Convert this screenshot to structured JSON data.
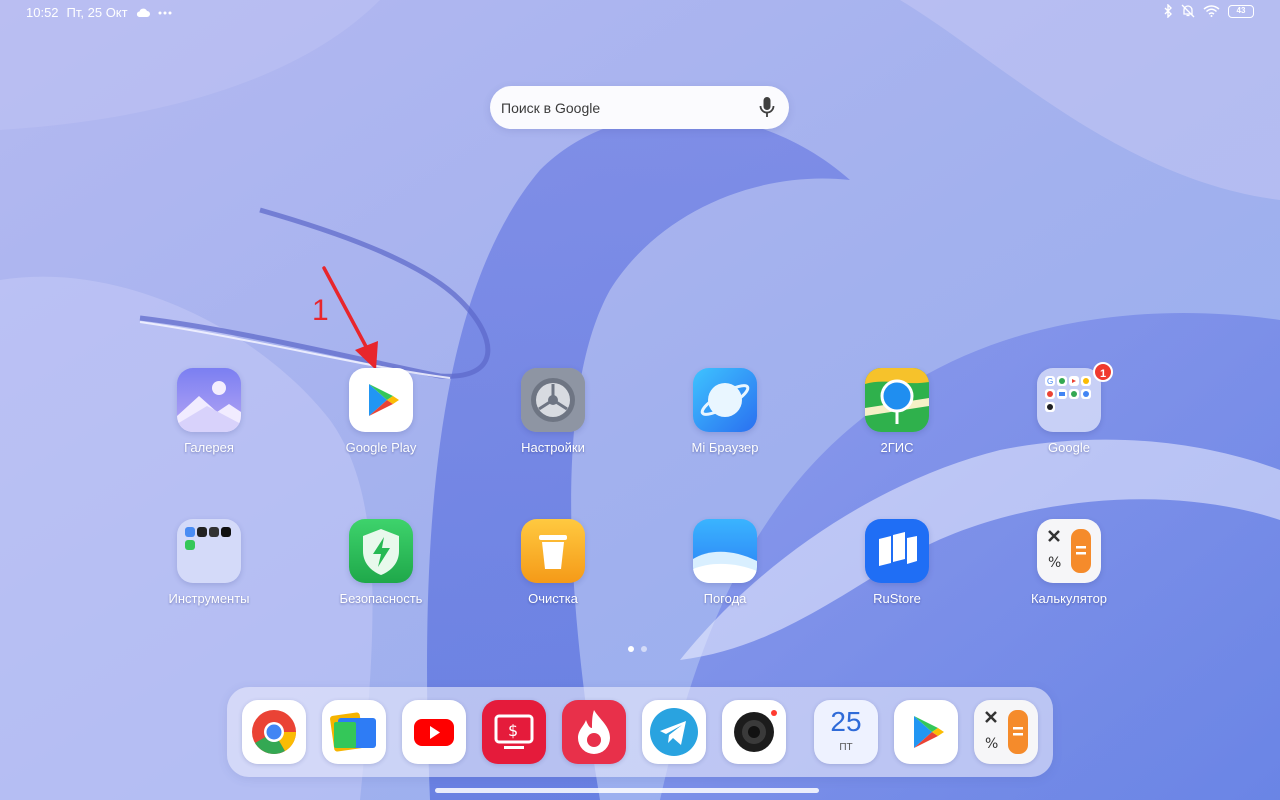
{
  "status_bar": {
    "time": "10:52",
    "date": "Пт, 25 Окт",
    "battery": "43",
    "icons": [
      "cloud-icon",
      "more-dots-icon",
      "bluetooth-icon",
      "mute-bell-icon",
      "wifi-icon",
      "battery-icon"
    ]
  },
  "search": {
    "placeholder": "Поиск в Google",
    "icon": "mic-icon"
  },
  "annotation": {
    "number": "1"
  },
  "apps": {
    "gallery": "Галерея",
    "google_play": "Google Play",
    "settings": "Настройки",
    "mi_browser": "Mi Браузер",
    "twogis": "2ГИС",
    "google_folder": "Google",
    "google_badge": "1",
    "tools": "Инструменты",
    "security": "Безопасность",
    "cleaner": "Очистка",
    "weather": "Погода",
    "rustore": "RuStore",
    "calculator": "Калькулятор"
  },
  "dock": {
    "calendar_day": "25",
    "calendar_weekday": "ПТ",
    "apps": [
      "chrome-icon",
      "files-icon",
      "youtube-icon",
      "tv-pay-icon",
      "flame-app-icon",
      "telegram-icon",
      "camera-icon",
      "calendar-icon",
      "google-play-icon",
      "calculator-icon"
    ]
  },
  "colors": {
    "wallpaper": "#a9b3ee",
    "annotation": "#e8262c",
    "badge": "#f03a2e"
  }
}
